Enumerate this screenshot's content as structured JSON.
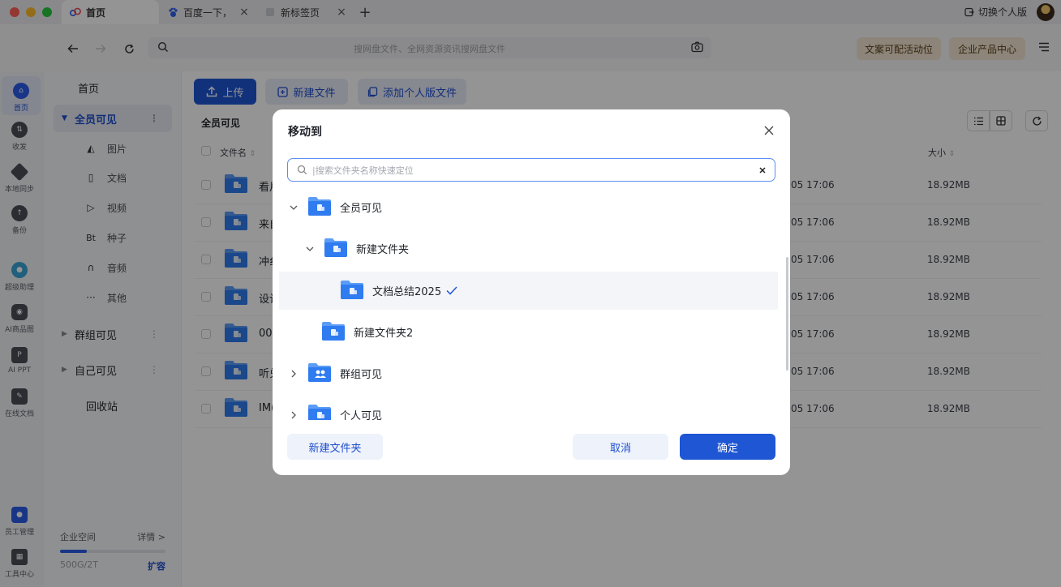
{
  "tabs": [
    {
      "label": "首页",
      "active": true
    },
    {
      "label": "百度一下，",
      "active": false
    },
    {
      "label": "新标签页",
      "active": false
    }
  ],
  "header": {
    "switch_personal": "切换个人版",
    "search_placeholder": "搜网盘文件、全网资源资讯搜网盘文件",
    "promo_left": "文案可配活动位",
    "promo_right": "企业产品中心"
  },
  "rail": [
    {
      "label": "首页",
      "icon": "home-icon"
    },
    {
      "label": "收发",
      "icon": "transfer-icon"
    },
    {
      "label": "本地同步",
      "icon": "sync-icon"
    },
    {
      "label": "备份",
      "icon": "backup-icon"
    },
    {
      "label": "超级助理",
      "icon": "assistant-icon"
    },
    {
      "label": "AI商品图",
      "icon": "ai-image-icon"
    },
    {
      "label": "AI PPT",
      "icon": "ai-ppt-icon"
    },
    {
      "label": "在线文档",
      "icon": "online-doc-icon"
    },
    {
      "label": "员工管理",
      "icon": "staff-icon"
    },
    {
      "label": "工具中心",
      "icon": "tools-icon"
    }
  ],
  "sidebar": {
    "home": "首页",
    "all_visible": "全员可见",
    "sub_items": [
      {
        "label": "图片",
        "icon": "image-icon"
      },
      {
        "label": "文档",
        "icon": "document-icon"
      },
      {
        "label": "视频",
        "icon": "video-icon"
      },
      {
        "label": "种子",
        "icon": "torrent-icon"
      },
      {
        "label": "音频",
        "icon": "audio-icon"
      },
      {
        "label": "其他",
        "icon": "more-icon"
      }
    ],
    "group_visible": "群组可见",
    "self_visible": "自己可见",
    "recycle": "回收站",
    "quota_title": "企业空间",
    "quota_detail": "详情 >",
    "quota_usage": "500G/2T",
    "quota_fraction": 0.25,
    "expand": "扩容"
  },
  "main": {
    "upload": "上传",
    "new_file": "新建文件",
    "add_personal": "添加个人版文件",
    "breadcrumb": "全员可见",
    "col_name": "文件名",
    "col_size": "大小",
    "rows": [
      {
        "name": "看片",
        "date": "05 17:06",
        "size": "18.92MB"
      },
      {
        "name": "来自",
        "date": "05 17:06",
        "size": "18.92MB"
      },
      {
        "name": "冲纟",
        "date": "05 17:06",
        "size": "18.92MB"
      },
      {
        "name": "设计",
        "date": "05 17:06",
        "size": "18.92MB"
      },
      {
        "name": "00",
        "date": "05 17:06",
        "size": "18.92MB"
      },
      {
        "name": "听兑",
        "date": "05 17:06",
        "size": "18.92MB"
      },
      {
        "name": "IM(",
        "date": "05 17:06",
        "size": "18.92MB"
      }
    ]
  },
  "modal": {
    "title": "移动到",
    "search_placeholder": "|搜索文件夹名称快速定位",
    "tree": [
      {
        "label": "全员可见",
        "level": 0,
        "arrow": "down"
      },
      {
        "label": "新建文件夹",
        "level": 1,
        "arrow": "down"
      },
      {
        "label": "文档总结2025",
        "level": 2,
        "arrow": "",
        "selected": true
      },
      {
        "label": "新建文件夹2",
        "level": 1,
        "arrow": ""
      },
      {
        "label": "群组可见",
        "level": 0,
        "arrow": "right"
      },
      {
        "label": "个人可见",
        "level": 0,
        "arrow": "right"
      }
    ],
    "new_folder": "新建文件夹",
    "cancel": "取消",
    "confirm": "确定"
  },
  "colors": {
    "accent": "#1e56d4",
    "folder": "#2f7bf0",
    "promo_bg": "#f3e6d3"
  }
}
